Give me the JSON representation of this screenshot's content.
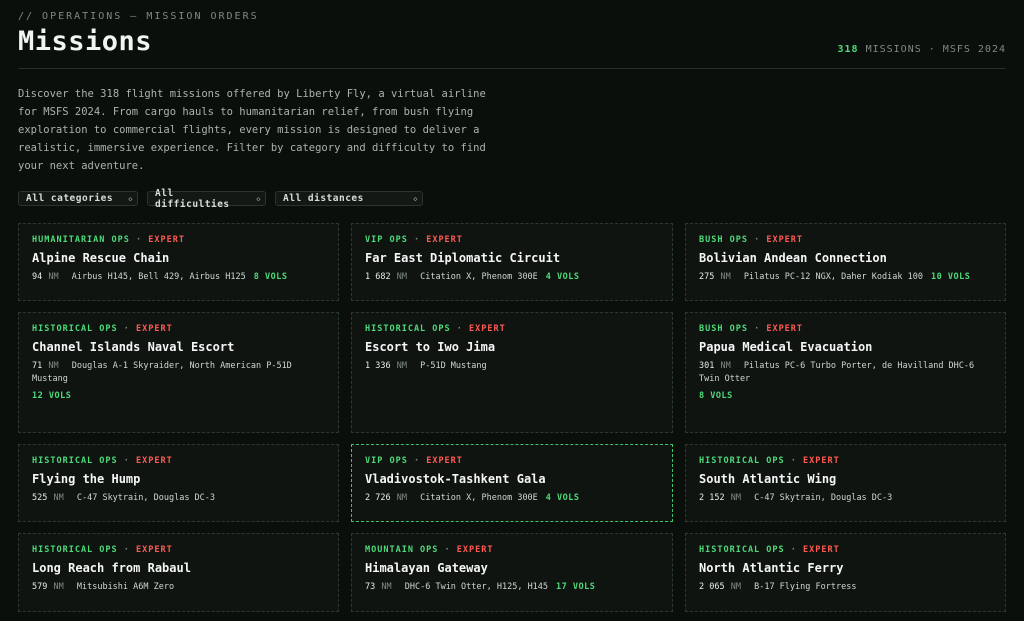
{
  "header": {
    "eyebrow": "// OPERATIONS — MISSION ORDERS",
    "title": "Missions",
    "stats_count": "318",
    "stats_text": "MISSIONS · MSFS 2024"
  },
  "intro": "Discover the 318 flight missions offered by Liberty Fly, a virtual airline for MSFS 2024. From cargo hauls to humanitarian relief, from bush flying exploration to commercial flights, every mission is designed to deliver a realistic, immersive experience. Filter by category and difficulty to find your next adventure.",
  "filters": {
    "category": "All categories",
    "difficulty": "All difficulties",
    "distance": "All distances"
  },
  "colors": {
    "accent": "#4ddb7a",
    "danger": "#ff5a52",
    "background": "#0b0f0c"
  },
  "missions": [
    {
      "category": "HUMANITARIAN OPS",
      "difficulty": "EXPERT",
      "title": "Alpine Rescue Chain",
      "distance": "94",
      "unit": "NM",
      "aircraft": "Airbus H145, Bell 429, Airbus H125",
      "vols": "8 VOLS"
    },
    {
      "category": "VIP OPS",
      "difficulty": "EXPERT",
      "title": "Far East Diplomatic Circuit",
      "distance": "1 682",
      "unit": "NM",
      "aircraft": "Citation X, Phenom 300E",
      "vols": "4 VOLS"
    },
    {
      "category": "BUSH OPS",
      "difficulty": "EXPERT",
      "title": "Bolivian Andean Connection",
      "distance": "275",
      "unit": "NM",
      "aircraft": "Pilatus PC-12 NGX, Daher Kodiak 100",
      "vols": "10 VOLS"
    },
    {
      "category": "HISTORICAL OPS",
      "difficulty": "EXPERT",
      "title": "Channel Islands Naval Escort",
      "distance": "71",
      "unit": "NM",
      "aircraft": "Douglas A-1 Skyraider, North American P-51D Mustang",
      "vols": "12 VOLS"
    },
    {
      "category": "HISTORICAL OPS",
      "difficulty": "EXPERT",
      "title": "Escort to Iwo Jima",
      "distance": "1 336",
      "unit": "NM",
      "aircraft": "P-51D Mustang",
      "vols": ""
    },
    {
      "category": "BUSH OPS",
      "difficulty": "EXPERT",
      "title": "Papua Medical Evacuation",
      "distance": "301",
      "unit": "NM",
      "aircraft": "Pilatus PC-6 Turbo Porter, de Havilland DHC-6 Twin Otter",
      "vols": "8 VOLS"
    },
    {
      "category": "HISTORICAL OPS",
      "difficulty": "EXPERT",
      "title": "Flying the Hump",
      "distance": "525",
      "unit": "NM",
      "aircraft": "C-47 Skytrain, Douglas DC-3",
      "vols": ""
    },
    {
      "category": "VIP OPS",
      "difficulty": "EXPERT",
      "title": "Vladivostok-Tashkent Gala",
      "distance": "2 726",
      "unit": "NM",
      "aircraft": "Citation X, Phenom 300E",
      "vols": "4 VOLS"
    },
    {
      "category": "HISTORICAL OPS",
      "difficulty": "EXPERT",
      "title": "South Atlantic Wing",
      "distance": "2 152",
      "unit": "NM",
      "aircraft": "C-47 Skytrain, Douglas DC-3",
      "vols": ""
    },
    {
      "category": "HISTORICAL OPS",
      "difficulty": "EXPERT",
      "title": "Long Reach from Rabaul",
      "distance": "579",
      "unit": "NM",
      "aircraft": "Mitsubishi A6M Zero",
      "vols": ""
    },
    {
      "category": "MOUNTAIN OPS",
      "difficulty": "EXPERT",
      "title": "Himalayan Gateway",
      "distance": "73",
      "unit": "NM",
      "aircraft": "DHC-6 Twin Otter, H125, H145",
      "vols": "17 VOLS"
    },
    {
      "category": "HISTORICAL OPS",
      "difficulty": "EXPERT",
      "title": "North Atlantic Ferry",
      "distance": "2 065",
      "unit": "NM",
      "aircraft": "B-17 Flying Fortress",
      "vols": ""
    }
  ]
}
